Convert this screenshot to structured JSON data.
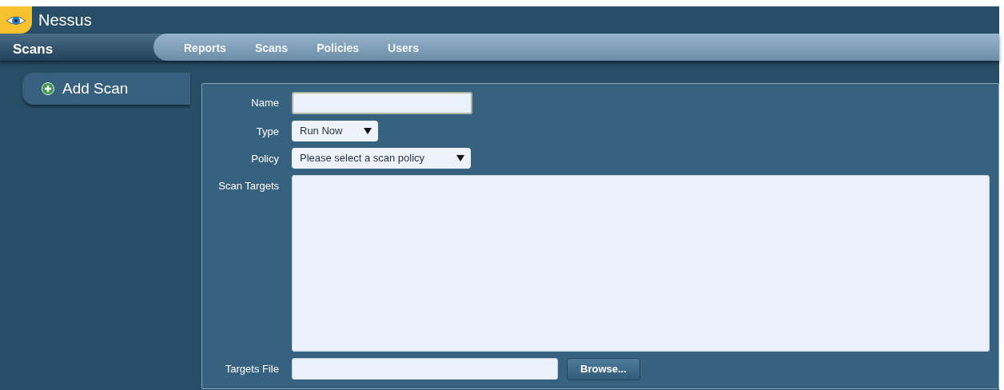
{
  "app": {
    "name": "Nessus"
  },
  "section_title": "Scans",
  "nav": [
    {
      "label": "Reports"
    },
    {
      "label": "Scans"
    },
    {
      "label": "Policies"
    },
    {
      "label": "Users"
    }
  ],
  "sidebar": {
    "items": [
      {
        "label": "Add Scan"
      }
    ]
  },
  "form": {
    "fields": [
      {
        "kind": "text",
        "label": "Name"
      },
      {
        "kind": "select",
        "label": "Type",
        "value": "Run Now"
      },
      {
        "kind": "select",
        "label": "Policy",
        "value": "Please select a scan policy"
      },
      {
        "kind": "textarea",
        "label": "Scan Targets"
      },
      {
        "kind": "file",
        "label": "Targets File",
        "button": "Browse..."
      }
    ]
  }
}
